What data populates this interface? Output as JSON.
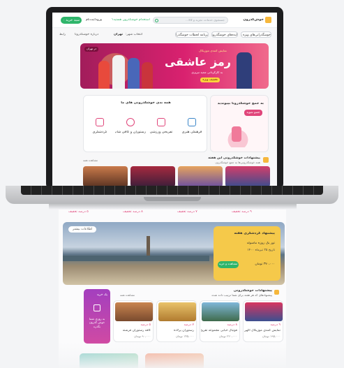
{
  "header": {
    "logo": "خوش‌گذرون",
    "search_placeholder": "جستجوی خدمات، تجربه و کالا...",
    "register_cta": "استخدام خوشگذرون هستید؟",
    "login_label": "ورود/ثبت‌نام",
    "cart_badge": "۰",
    "cart_label": "سبد خرید"
  },
  "nav": {
    "items": [
      "خوشگذرانی‌های ویژه هفته",
      "ایده‌های خوشگذرونی",
      "برنامه لحظات خوشگذرانی"
    ],
    "city_prefix": "انتخاب شهر:",
    "city": "تهران",
    "about": "درباره خوشگذرونا",
    "contact": "رابط"
  },
  "top_banner": {
    "small_tag": "در تهران",
    "line1": "نمایش کمدی موزیکال",
    "title": "رمز عاشقی",
    "line3": "به کارگردانی مجید تبریزی",
    "badge": "تخفیف ویژه"
  },
  "categories": {
    "heading": "همه بدی خوشگذرونی های ما",
    "items": [
      {
        "label": "گردشگری",
        "icon": "suitcase-icon"
      },
      {
        "label": "رستوران و کافی شاپ",
        "icon": "food-icon"
      },
      {
        "label": "تفریحی ورزشی",
        "icon": "ticket-icon"
      },
      {
        "label": "فرهنگی هنری",
        "icon": "theater-icon"
      }
    ]
  },
  "join": {
    "title": "به جمع خوشگذرونا بپیوندید",
    "button": "عضو شوید"
  },
  "suggest": {
    "title": "پیشنهادات خوشگذرونی این هفته",
    "sub": "همه خوشگذرونی‌ها به جمع خوشگذرون",
    "link": "مشاهده همه"
  },
  "row_prices": [
    "۵ درصد تخفیف",
    "۸ درصد تخفیف",
    "۷ درصد تخفیف",
    "۹ درصد تخفیف"
  ],
  "tour": {
    "tag": "اطلاعات بیشتر",
    "title": "پیشنهاد گردشگری هفته",
    "place": "تور یک روزه ماسوله",
    "date": "تاریخ ۲۵ تیرماه ۱۴۰۰",
    "price": "۳۷۰،۰۰۰ تومان",
    "button": "مشاهده و خرید"
  },
  "section2": {
    "title": "پیشنهادات خوشگذرونی",
    "sub": "پیشنهادهای که هر هفته برای شما ترتیب داده شده"
  },
  "promo": {
    "label": "یک خرید",
    "text": "به روزی شما خوش گذرون بگذره"
  },
  "cards": [
    {
      "discount": "۹ درصد",
      "title": "نمایش کمدی موزیکال آگهی",
      "price": "۱۹۵،۰۰۰ تومان"
    },
    {
      "discount": "۸ درصد",
      "title": "فوتبال حبابی مجموعه تفریح",
      "price": "۲۲۰،۰۰۰ تومان"
    },
    {
      "discount": "۷ درصد",
      "title": "رستوران پرلاده",
      "price": "۱۴۵،۰۰۰ تومان"
    },
    {
      "discount": "۵ درصد",
      "title": "کافه رستوران فرشته",
      "price": "۹۰،۰۰۰ تومان"
    }
  ],
  "colors": {
    "accent_green": "#2fb56b",
    "accent_pink": "#e0457a",
    "banner_magenta": "#c41f66"
  }
}
